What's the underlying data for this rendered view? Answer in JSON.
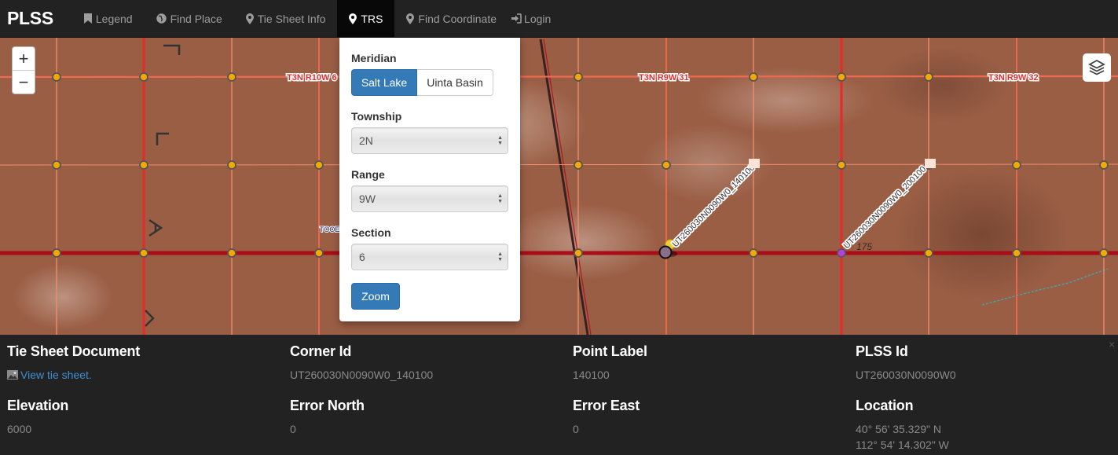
{
  "navbar": {
    "brand": "PLSS",
    "items": [
      {
        "label": "Legend",
        "icon": "bookmark-icon",
        "active": false
      },
      {
        "label": "Find Place",
        "icon": "globe-icon",
        "active": false
      },
      {
        "label": "Tie Sheet Info",
        "icon": "map-marker-icon",
        "active": false
      },
      {
        "label": "TRS",
        "icon": "map-marker-icon",
        "active": true
      },
      {
        "label": "Find Coordinate",
        "icon": "map-marker-icon",
        "active": false
      },
      {
        "label": "Login",
        "icon": "log-in-icon",
        "active": false
      }
    ]
  },
  "map": {
    "zoom_in": "+",
    "zoom_out": "−",
    "layers_icon": "layers-icon",
    "labels": {
      "township_range_1": "T3N R10W 6",
      "township_range_2": "T3N R9W 31",
      "township_range_3": "T3N R9W 32",
      "county": "TOOELE",
      "corner_label_1": "UT260030N0090W0_140100",
      "corner_label_2": "UT260030N0090W0_200100",
      "elev_mark": "175"
    },
    "colors": {
      "township_line": "#e8392e",
      "section_line": "#f0806a",
      "baseline": "#a90d18",
      "corner_dot": "#f5a800",
      "selected_corner": "#b040e0"
    }
  },
  "trs": {
    "meridian_label": "Meridian",
    "meridian_options": [
      "Salt Lake",
      "Uinta Basin"
    ],
    "meridian_selected": "Salt Lake",
    "township_label": "Township",
    "township_value": "2N",
    "range_label": "Range",
    "range_value": "9W",
    "section_label": "Section",
    "section_value": "6",
    "zoom_button": "Zoom"
  },
  "info": {
    "tie_sheet_title": "Tie Sheet Document",
    "tie_sheet_link": "View tie sheet.",
    "corner_id_title": "Corner Id",
    "corner_id": "UT260030N0090W0_140100",
    "point_label_title": "Point Label",
    "point_label": "140100",
    "plss_id_title": "PLSS Id",
    "plss_id": "UT260030N0090W0",
    "elevation_title": "Elevation",
    "elevation": "6000",
    "error_north_title": "Error North",
    "error_north": "0",
    "error_east_title": "Error East",
    "error_east": "0",
    "location_title": "Location",
    "location_lat": "40° 56' 35.329\" N",
    "location_lon": "112° 54' 14.302\" W",
    "close": "×"
  }
}
